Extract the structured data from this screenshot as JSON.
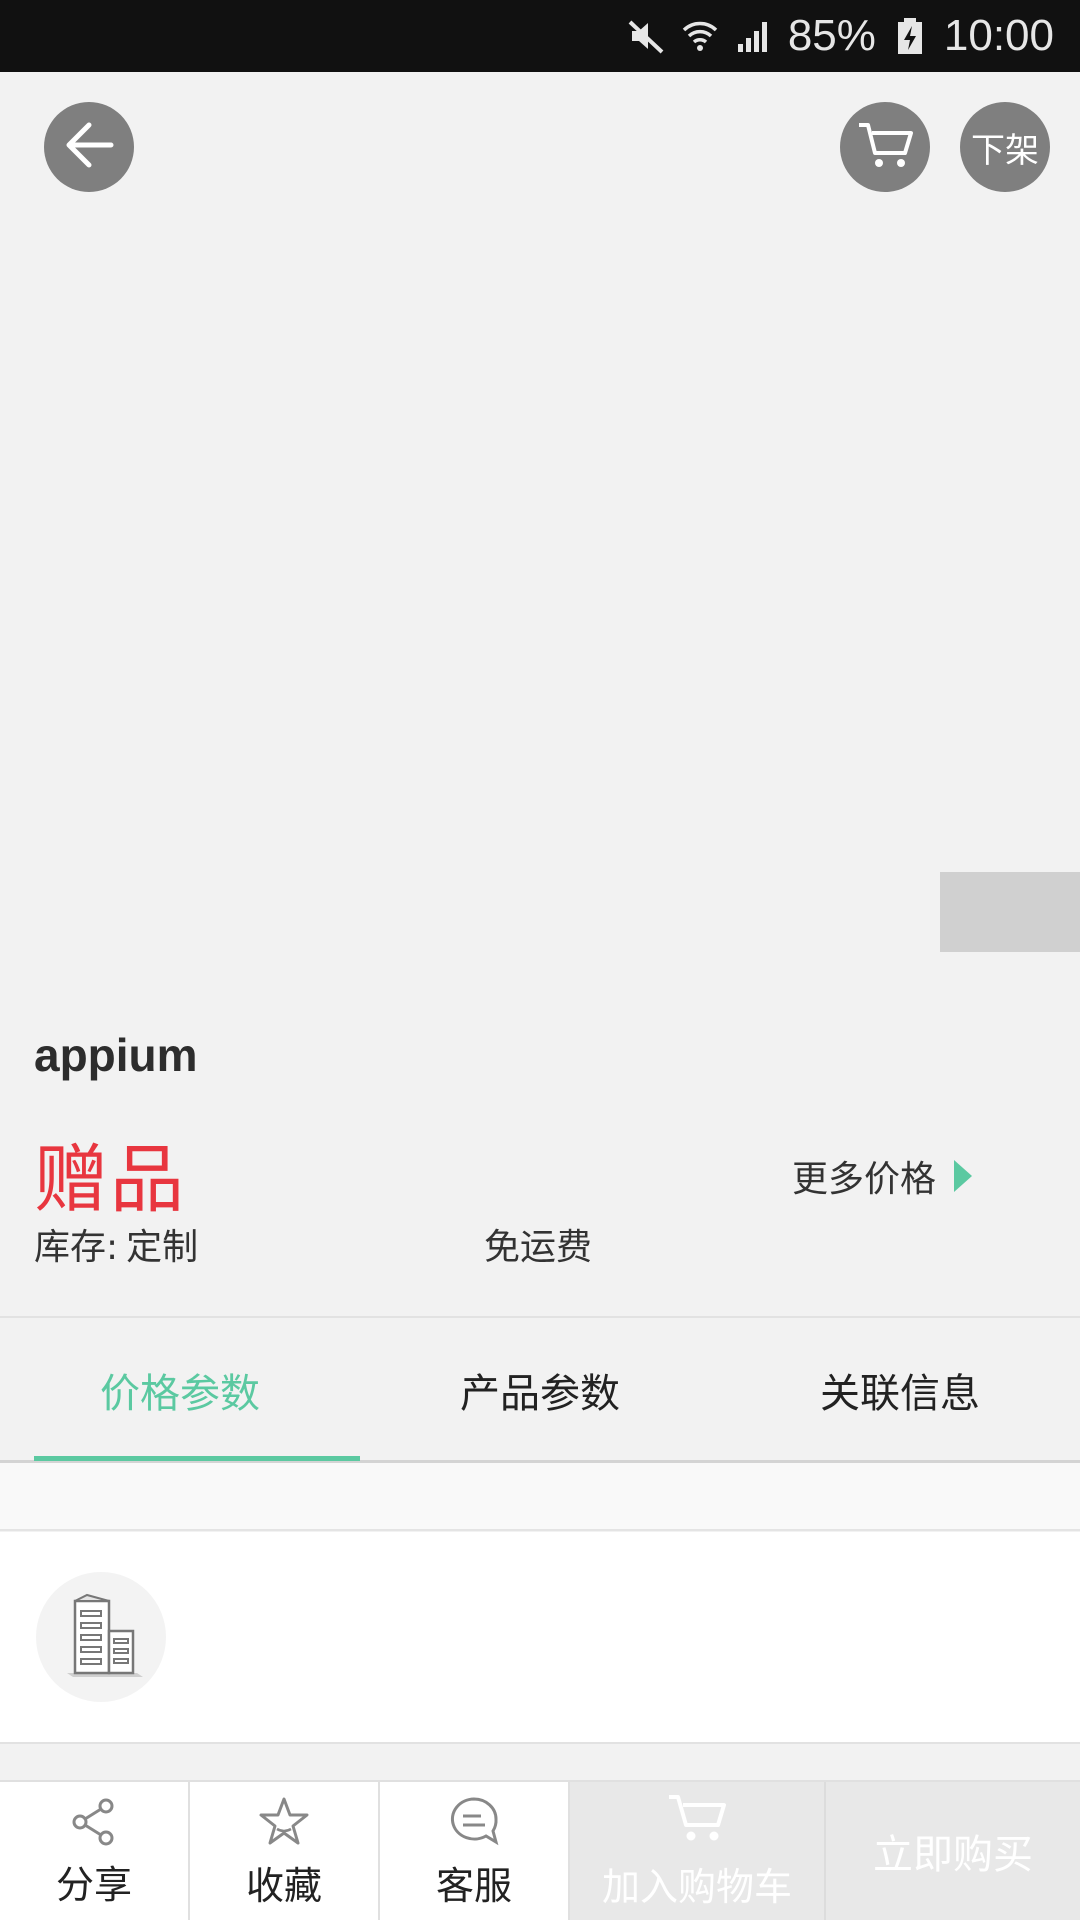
{
  "status_bar": {
    "battery_percent": "85%",
    "time": "10:00",
    "icons": [
      "mute-icon",
      "wifi-icon",
      "signal-icon",
      "battery-charging-icon"
    ]
  },
  "header": {
    "back_icon": "back-arrow-icon",
    "cart_icon": "cart-icon",
    "offshelf_label": "下架"
  },
  "product": {
    "name": "appium",
    "price_label": "赠品",
    "more_price_label": "更多价格",
    "stock_label": "库存:",
    "stock_value": "定制",
    "shipping_label": "免运费"
  },
  "tabs": [
    {
      "label": "价格参数",
      "active": true
    },
    {
      "label": "产品参数",
      "active": false
    },
    {
      "label": "关联信息",
      "active": false
    }
  ],
  "company": {
    "logo_icon": "building-icon"
  },
  "bottom_bar": {
    "share_label": "分享",
    "favorite_label": "收藏",
    "service_label": "客服",
    "add_cart_label": "加入购物车",
    "buy_now_label": "立即购买"
  },
  "colors": {
    "accent": "#5bc9a1",
    "price_red": "#e8363f",
    "disabled_bg": "#e8e8e8"
  }
}
